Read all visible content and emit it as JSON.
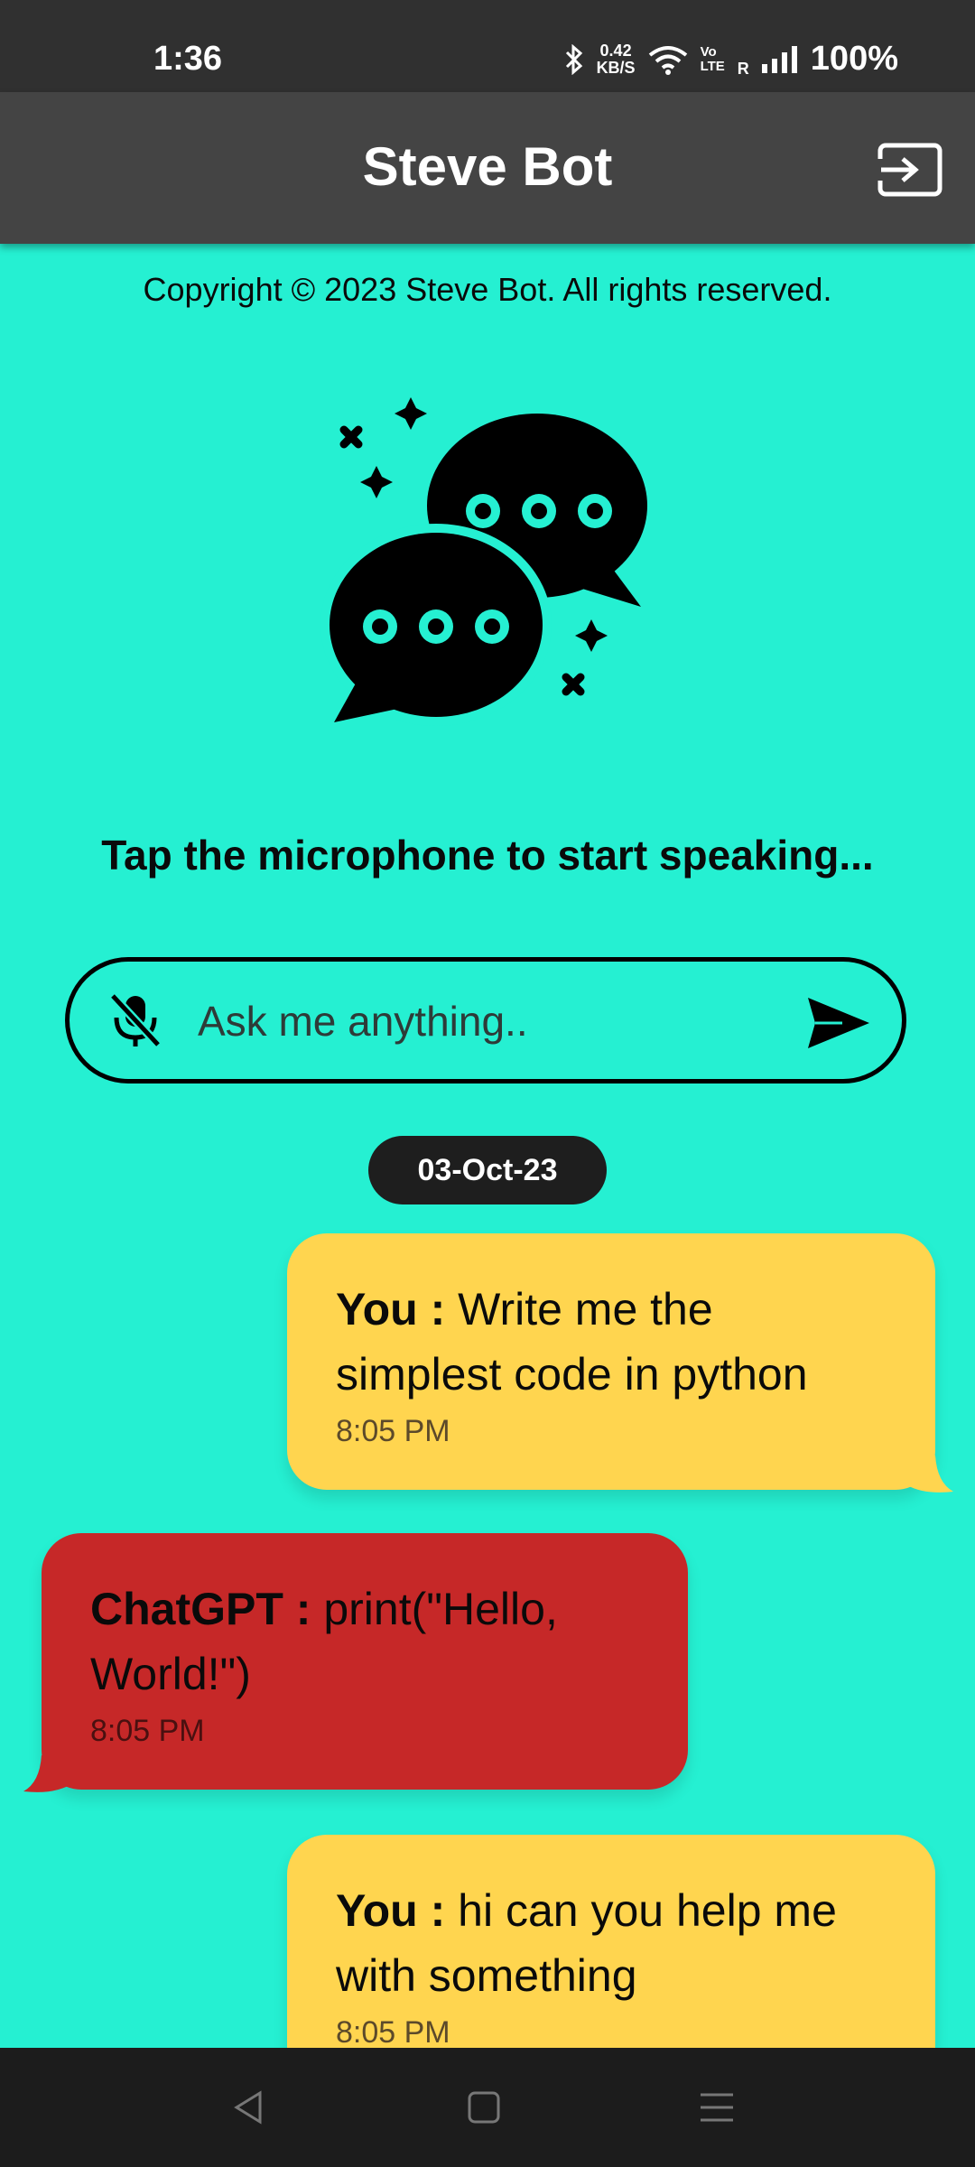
{
  "status_bar": {
    "time": "1:36",
    "net_speed_value": "0.42",
    "net_speed_unit": "KB/S",
    "volte_top": "Vo",
    "volte_bottom": "LTE",
    "roaming": "R",
    "battery": "100%"
  },
  "app_bar": {
    "title": "Steve Bot",
    "logout_icon": "logout-icon"
  },
  "copyright": "Copyright © 2023 Steve Bot. All rights reserved.",
  "hint": "Tap the microphone to start speaking...",
  "input": {
    "placeholder": "Ask me anything..",
    "mic_icon": "mic-off-icon",
    "send_icon": "send-icon"
  },
  "date_label": "03-Oct-23",
  "messages": [
    {
      "speaker": "You :",
      "text": "Write me the simplest code in python",
      "time": "8:05 PM"
    },
    {
      "speaker": "ChatGPT :",
      "text": "print(\"Hello, World!\")",
      "time": "8:05 PM"
    },
    {
      "speaker": "You :",
      "text": "hi can you help me with something",
      "time": "8:05 PM"
    }
  ],
  "colors": {
    "background": "#25F0D2",
    "app_bar": "#444444",
    "user_bubble": "#FFD54F",
    "bot_bubble": "#C62828"
  }
}
